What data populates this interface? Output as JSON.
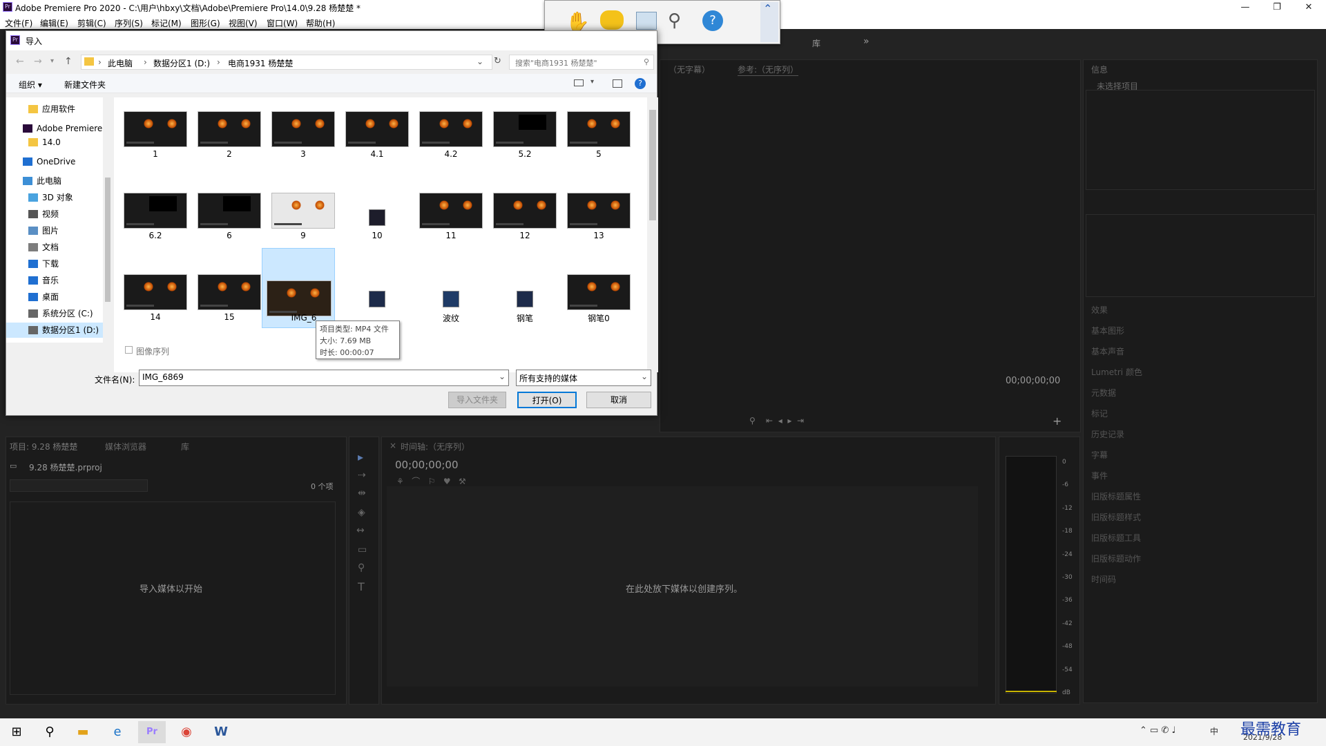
{
  "window": {
    "title": "Adobe Premiere Pro 2020 - C:\\用户\\hbxy\\文档\\Adobe\\Premiere Pro\\14.0\\9.28 杨楚楚 *",
    "app_icon": "Pr"
  },
  "menu": [
    "文件(F)",
    "编辑(E)",
    "剪辑(C)",
    "序列(S)",
    "标记(M)",
    "图形(G)",
    "视图(V)",
    "窗口(W)",
    "帮助(H)"
  ],
  "dialog": {
    "title": "导入",
    "breadcrumb": [
      "此电脑",
      "数据分区1 (D:)",
      "电商1931 杨楚楚"
    ],
    "search_placeholder": "搜索\"电商1931 杨楚楚\"",
    "organize": "组织 ▾",
    "new_folder": "新建文件夹",
    "nav": [
      {
        "label": "应用软件",
        "icon": "folder-icon"
      },
      {
        "label": "Adobe Premiere",
        "icon": "premiere-icon"
      },
      {
        "label": "14.0",
        "icon": "folder-icon"
      },
      {
        "label": "OneDrive",
        "icon": "cloud-icon"
      },
      {
        "label": "此电脑",
        "icon": "computer-icon"
      },
      {
        "label": "3D 对象",
        "icon": "cube-icon"
      },
      {
        "label": "视频",
        "icon": "video-icon"
      },
      {
        "label": "图片",
        "icon": "picture-icon"
      },
      {
        "label": "文档",
        "icon": "document-icon"
      },
      {
        "label": "下载",
        "icon": "download-icon"
      },
      {
        "label": "音乐",
        "icon": "music-icon"
      },
      {
        "label": "桌面",
        "icon": "desktop-icon"
      },
      {
        "label": "系统分区 (C:)",
        "icon": "drive-icon"
      },
      {
        "label": "数据分区1 (D:)",
        "icon": "drive-icon"
      }
    ],
    "files_row1": [
      "1",
      "2",
      "3",
      "4.1",
      "4.2",
      "5.2",
      "5"
    ],
    "files_row2": [
      "6.2",
      "6",
      "9",
      "10",
      "11",
      "12",
      "13"
    ],
    "files_row3": [
      "14",
      "15",
      "IMG_6",
      "",
      "波纹",
      "钢笔",
      "钢笔0"
    ],
    "tooltip": {
      "type": "项目类型: MP4 文件",
      "size": "大小: 7.69 MB",
      "duration": "时长: 00:00:07"
    },
    "image_sequence": "图像序列",
    "filename_label": "文件名(N):",
    "filename_value": "IMG_6869",
    "filter": "所有支持的媒体",
    "import_folder": "导入文件夹",
    "open": "打开(O)",
    "cancel": "取消"
  },
  "premiere": {
    "source_tab_a": "（无字幕）",
    "reference_tab": "参考:（无序列）",
    "info_title": "信息",
    "no_selection": "未选择项目",
    "right_panels": [
      "效果",
      "基本图形",
      "基本声音",
      "Lumetri 颜色",
      "元数据",
      "标记",
      "历史记录",
      "字幕",
      "事件",
      "旧版标题属性",
      "旧版标题样式",
      "旧版标题工具",
      "旧版标题动作",
      "时间码"
    ],
    "program_timecode": "00;00;00;00",
    "library": "库",
    "project_tab": "项目: 9.28 杨楚楚",
    "media_browser": "媒体浏览器",
    "library2": "库",
    "project_file": "9.28 杨楚楚.prproj",
    "item_count": "0 个项",
    "import_hint": "导入媒体以开始",
    "timeline_tab": "时间轴:（无序列）",
    "timeline_timecode": "00;00;00;00",
    "timeline_hint": "在此处放下媒体以创建序列。",
    "meter_ticks": [
      "0",
      "-6",
      "-12",
      "-18",
      "-24",
      "-30",
      "-36",
      "-42",
      "-48",
      "-54",
      "dB"
    ]
  },
  "taskbar": {
    "date": "2021/9/28",
    "ime": "中",
    "watermark": "最需教育"
  }
}
